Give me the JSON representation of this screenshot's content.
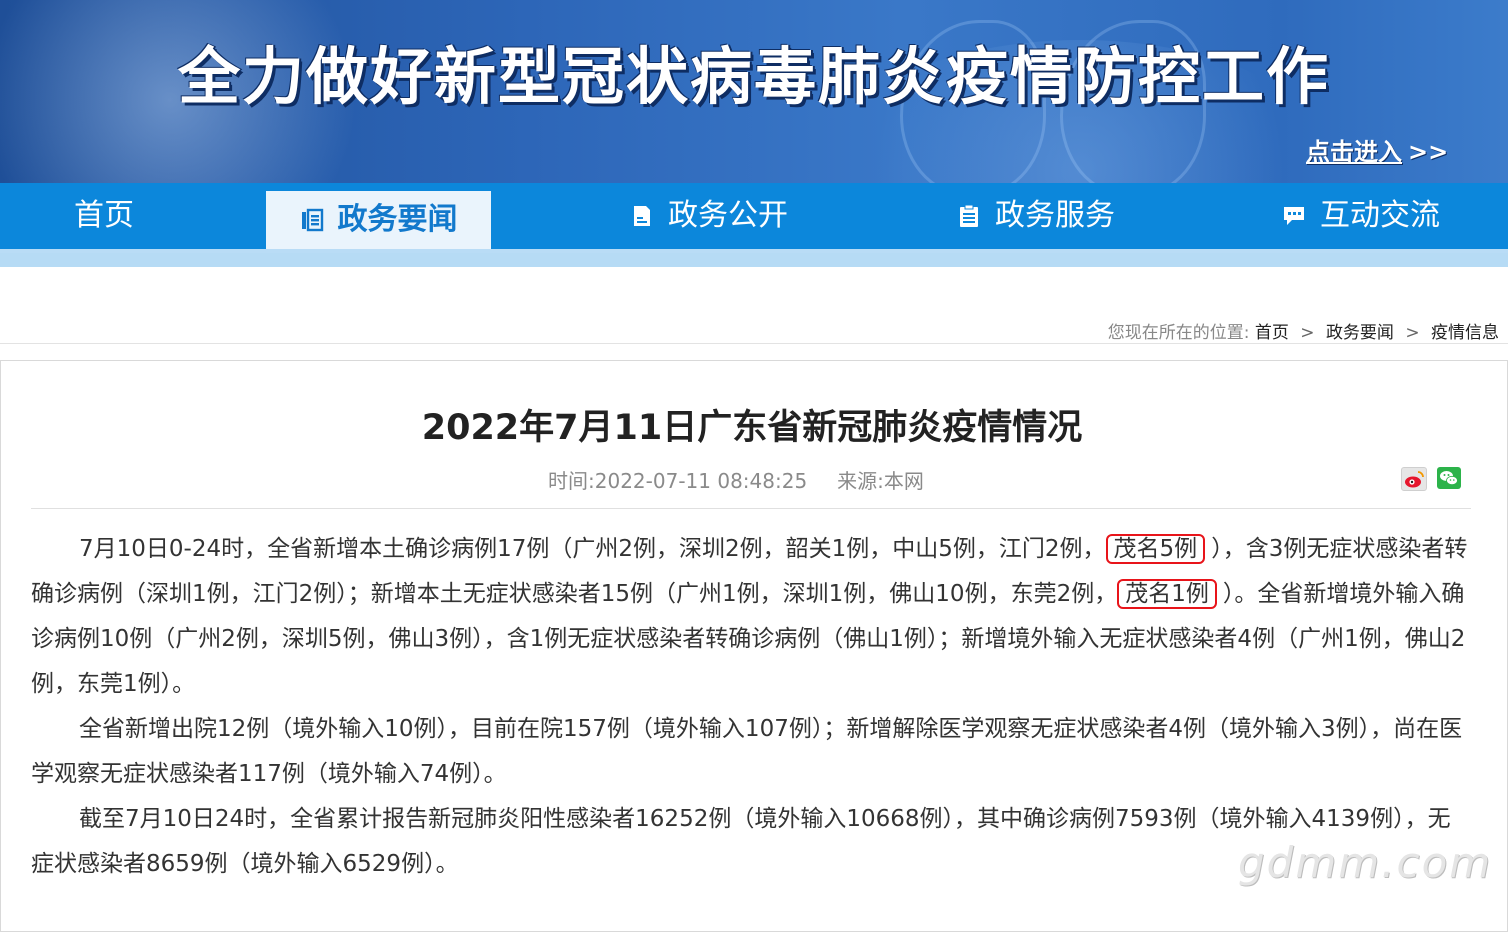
{
  "banner": {
    "title": "全力做好新型冠状病毒肺炎疫情防控工作",
    "enter_link": "点击进入",
    "enter_arrows": ">>"
  },
  "nav": {
    "items": [
      {
        "label": "首页",
        "icon": "none",
        "active": false
      },
      {
        "label": "政务要闻",
        "icon": "news-list-icon",
        "active": true
      },
      {
        "label": "政务公开",
        "icon": "document-icon",
        "active": false
      },
      {
        "label": "政务服务",
        "icon": "clipboard-icon",
        "active": false
      },
      {
        "label": "互动交流",
        "icon": "chat-icon",
        "active": false
      }
    ],
    "colors": {
      "bar": "#0c87db",
      "active_bg": "#eaf4fc",
      "active_text": "#1279cc"
    }
  },
  "breadcrumb": {
    "prefix": "您现在所在的位置:",
    "items": [
      "首页",
      "政务要闻",
      "疫情信息"
    ],
    "separator": ">"
  },
  "article": {
    "title": "2022年7月11日广东省新冠肺炎疫情情况",
    "time_label": "时间:",
    "time": "2022-07-11 08:48:25",
    "source_label": "来源:",
    "source": "本网",
    "share_icons": [
      "weibo-icon",
      "wechat-icon"
    ],
    "p1": {
      "a": "7月10日0-24时，全省新增本土确诊病例17例（广州2例，深圳2例，韶关1例，中山5例，江门2例，",
      "h1": "茂名5例",
      "b": "），含3例无症状感染者转确诊病例（深圳1例，江门2例）；新增本土无症状感染者15例（广州1例，深圳1例，佛山10例，东莞2例，",
      "h2": "茂名1例",
      "c": "）。全省新增境外输入确诊病例10例（广州2例，深圳5例，佛山3例），含1例无症状感染者转确诊病例（佛山1例）；新增境外输入无症状感染者4例（广州1例，佛山2例，东莞1例）。"
    },
    "p2": "全省新增出院12例（境外输入10例），目前在院157例（境外输入107例）；新增解除医学观察无症状感染者4例（境外输入3例），尚在医学观察无症状感染者117例（境外输入74例）。",
    "p3": "截至7月10日24时，全省累计报告新冠肺炎阳性感染者16252例（境外输入10668例），其中确诊病例7593例（境外输入4139例），无症状感染者8659例（境外输入6529例）。",
    "highlight_color": "#e8141a"
  },
  "watermark": "gdmm.com"
}
